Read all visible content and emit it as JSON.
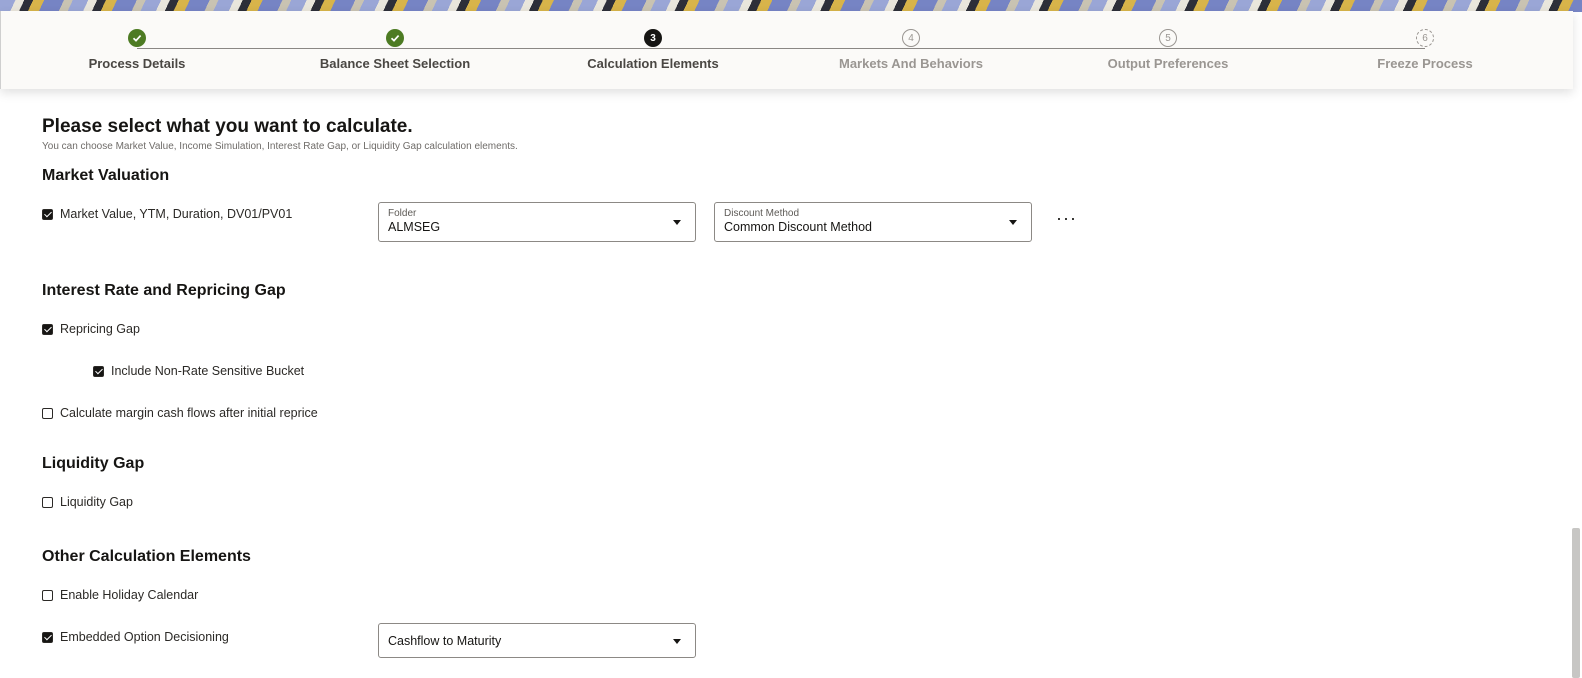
{
  "train": {
    "steps": [
      {
        "number": "1",
        "label": "Process Details",
        "state": "done"
      },
      {
        "number": "2",
        "label": "Balance Sheet Selection",
        "state": "done"
      },
      {
        "number": "3",
        "label": "Calculation Elements",
        "state": "current"
      },
      {
        "number": "4",
        "label": "Markets And Behaviors",
        "state": "todo"
      },
      {
        "number": "5",
        "label": "Output Preferences",
        "state": "todo"
      },
      {
        "number": "6",
        "label": "Freeze Process",
        "state": "todo"
      }
    ]
  },
  "page": {
    "title": "Please select what you want to calculate.",
    "subtitle": "You can choose Market Value, Income Simulation, Interest Rate Gap, or Liquidity Gap calculation elements."
  },
  "market_valuation": {
    "heading": "Market Valuation",
    "checkbox_label": "Market Value, YTM, Duration, DV01/PV01",
    "checked": true,
    "folder": {
      "label": "Folder",
      "value": "ALMSEG"
    },
    "discount_method": {
      "label": "Discount Method",
      "value": "Common Discount Method"
    },
    "more_label": "···"
  },
  "gap": {
    "heading": "Interest Rate and Repricing Gap",
    "repricing_gap": {
      "label": "Repricing Gap",
      "checked": true
    },
    "non_rate_bucket": {
      "label": "Include Non-Rate Sensitive Bucket",
      "checked": true
    },
    "margin_cash_flows": {
      "label": "Calculate margin cash flows after initial reprice",
      "checked": false
    }
  },
  "liquidity": {
    "heading": "Liquidity Gap",
    "liquidity_gap": {
      "label": "Liquidity Gap",
      "checked": false
    }
  },
  "other": {
    "heading": "Other Calculation Elements",
    "holiday_calendar": {
      "label": "Enable Holiday Calendar",
      "checked": false
    },
    "embedded_option": {
      "label": "Embedded Option Decisioning",
      "checked": true
    },
    "embedded_option_select": {
      "value": "Cashflow to Maturity"
    }
  },
  "colors": {
    "done": "#4d7b23",
    "current": "#161513",
    "todo": "#9a9692"
  }
}
